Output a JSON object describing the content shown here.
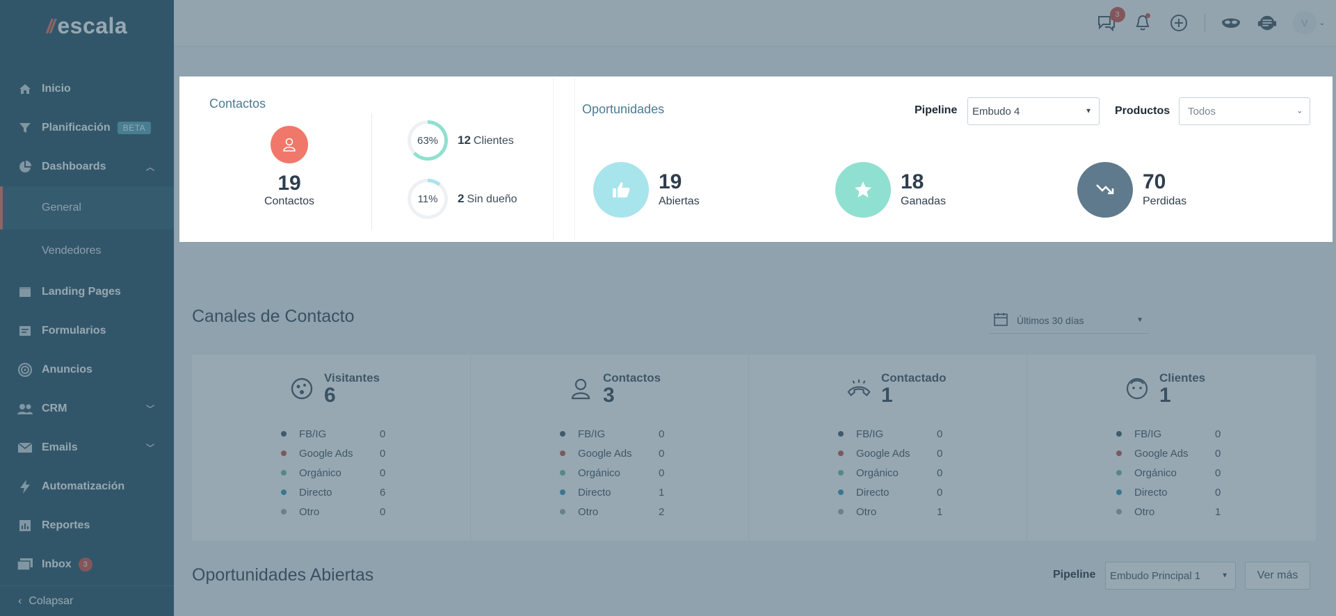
{
  "app": {
    "logo_text": "escala",
    "logo_mark": "//"
  },
  "sidebar": {
    "items": [
      {
        "label": "Inicio",
        "icon": "home-icon"
      },
      {
        "label": "Planificación",
        "icon": "filter-icon",
        "badge": "BETA"
      },
      {
        "label": "Dashboards",
        "icon": "pie-chart-icon",
        "expanded": true
      },
      {
        "label": "General",
        "sub": true,
        "active": true
      },
      {
        "label": "Vendedores",
        "sub": true
      },
      {
        "label": "Landing Pages",
        "icon": "browser-icon"
      },
      {
        "label": "Formularios",
        "icon": "form-icon"
      },
      {
        "label": "Anuncios",
        "icon": "target-icon"
      },
      {
        "label": "CRM",
        "icon": "users-icon",
        "expandable": true
      },
      {
        "label": "Emails",
        "icon": "mail-icon",
        "expandable": true
      },
      {
        "label": "Automatización",
        "icon": "bolt-icon"
      },
      {
        "label": "Reportes",
        "icon": "report-icon"
      },
      {
        "label": "Inbox",
        "icon": "inbox-icon",
        "count": "3"
      }
    ],
    "collapse_label": "Colapsar"
  },
  "topbar": {
    "chat_badge": "3",
    "avatar_initial": "V"
  },
  "contactos_card": {
    "title": "Contactos",
    "total": "19",
    "total_label": "Contactos",
    "clientes_pct": "63%",
    "clientes_pct_value": 63,
    "clientes_count": "12",
    "clientes_label": "Clientes",
    "sin_dueno_pct": "11%",
    "sin_dueno_pct_value": 11,
    "sin_dueno_count": "2",
    "sin_dueno_label": "Sin dueño"
  },
  "oportunidades_card": {
    "title": "Oportunidades",
    "pipeline_label": "Pipeline",
    "pipeline_value": "Embudo 4",
    "productos_label": "Productos",
    "productos_value": "Todos",
    "abiertas": {
      "value": "19",
      "label": "Abiertas"
    },
    "ganadas": {
      "value": "18",
      "label": "Ganadas"
    },
    "perdidas": {
      "value": "70",
      "label": "Perdidas"
    }
  },
  "canales": {
    "title": "Canales de Contacto",
    "date_filter": "Últimos 30 días",
    "columns": [
      {
        "name": "Visitantes",
        "total": "6",
        "icon": "face-icon",
        "values": [
          "0",
          "0",
          "0",
          "6",
          "0"
        ]
      },
      {
        "name": "Contactos",
        "total": "3",
        "icon": "user-icon",
        "values": [
          "0",
          "0",
          "0",
          "1",
          "2"
        ]
      },
      {
        "name": "Contactado",
        "total": "1",
        "icon": "phone-ringing-icon",
        "values": [
          "0",
          "0",
          "0",
          "0",
          "1"
        ]
      },
      {
        "name": "Clientes",
        "total": "1",
        "icon": "smile-icon",
        "values": [
          "0",
          "0",
          "0",
          "0",
          "1"
        ]
      }
    ],
    "sources": [
      "FB/IG",
      "Google Ads",
      "Orgánico",
      "Directo",
      "Otro"
    ],
    "source_colors": [
      "#3e5566",
      "#c0504a",
      "#6fb6a8",
      "#2f93b5",
      "#9aa7b1"
    ]
  },
  "oportunidades_abiertas": {
    "title": "Oportunidades Abiertas",
    "pipeline_label": "Pipeline",
    "pipeline_value": "Embudo Principal 1",
    "ver_mas": "Ver más"
  },
  "colors": {
    "sidebar": "#1f4a5e",
    "accent_red": "#f0786a",
    "abiertas": "#a8e4ec",
    "ganadas": "#8fe0d0",
    "perdidas": "#5e7a8c"
  }
}
